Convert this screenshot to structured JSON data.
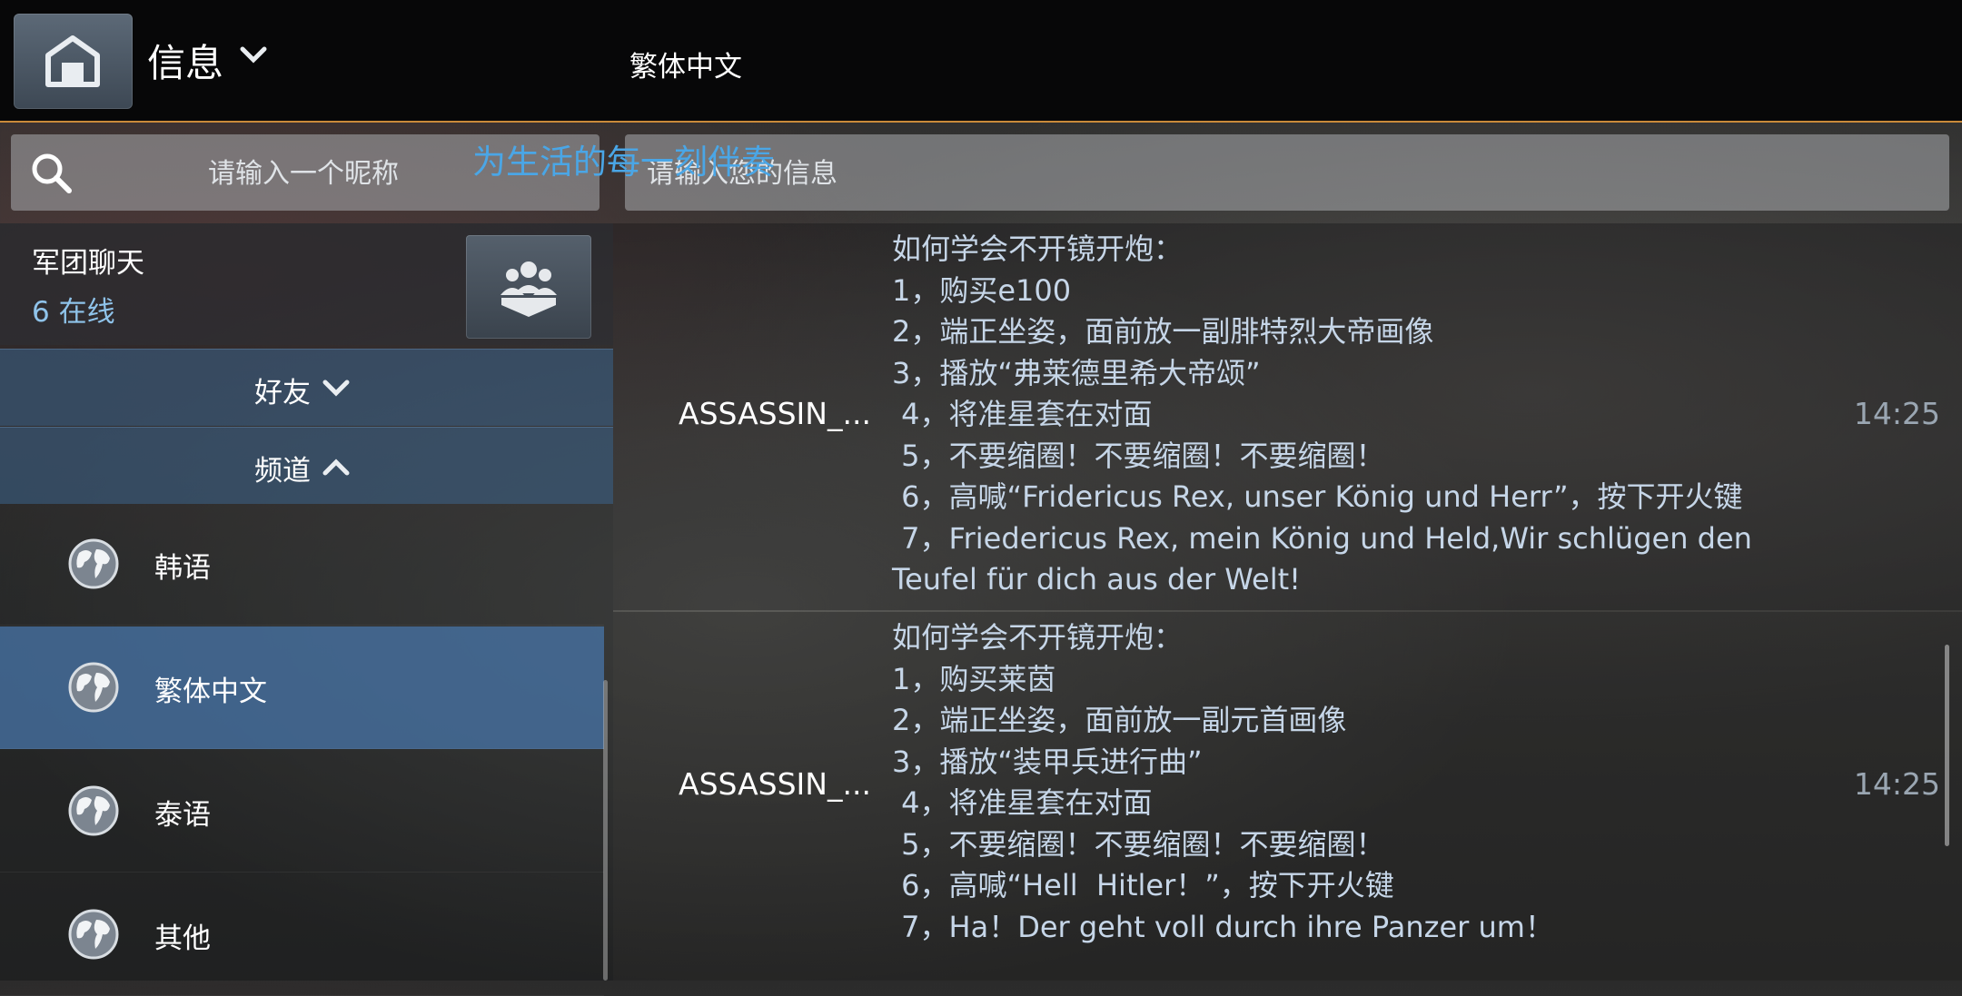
{
  "header": {
    "app_title": "信息",
    "channel_title": "繁体中文"
  },
  "search": {
    "placeholder": "请输入一个昵称"
  },
  "message_input": {
    "placeholder": "请输入您的信息"
  },
  "banner": {
    "slogan": "为生活的每一刻伴奏"
  },
  "clan": {
    "title": "军团聊天",
    "online": "6 在线"
  },
  "sidebar": {
    "friends_label": "好友",
    "channels_label": "频道",
    "channels": [
      {
        "label": "韩语"
      },
      {
        "label": "繁体中文"
      },
      {
        "label": "泰语"
      },
      {
        "label": "其他"
      }
    ]
  },
  "messages": [
    {
      "sender": "ASSASSIN_...",
      "time": "14:25",
      "lines": [
        "如何学会不开镜开炮：",
        "1，购买e100",
        "2，端正坐姿，面前放一副腓特烈大帝画像",
        "3，播放“弗莱德里希大帝颂”",
        " 4，将准星套在对面",
        " 5，不要缩圈！不要缩圈！不要缩圈！",
        " 6，高喊“Fridericus Rex, unser König und Herr”，按下开火键",
        " 7，Friedericus Rex, mein König und Held,Wir schlügen den",
        "Teufel für dich aus der Welt!"
      ]
    },
    {
      "sender": "ASSASSIN_...",
      "time": "14:25",
      "lines": [
        "如何学会不开镜开炮：",
        "1，购买莱茵",
        "2，端正坐姿，面前放一副元首画像",
        "3，播放“装甲兵进行曲”",
        " 4，将准星套在对面",
        " 5，不要缩圈！不要缩圈！不要缩圈！",
        " 6，高喊“Hell  Hitler！”，按下开火键",
        " 7，Ha！Der geht voll durch ihre Panzer um！"
      ]
    }
  ],
  "colors": {
    "accent": "#4aa6e6",
    "active_item": "#4876aa",
    "divider": "#c98a3a"
  },
  "icons": {
    "home": "home-icon",
    "search": "search-icon",
    "clan": "clan-group-icon",
    "globe": "globe-icon"
  }
}
